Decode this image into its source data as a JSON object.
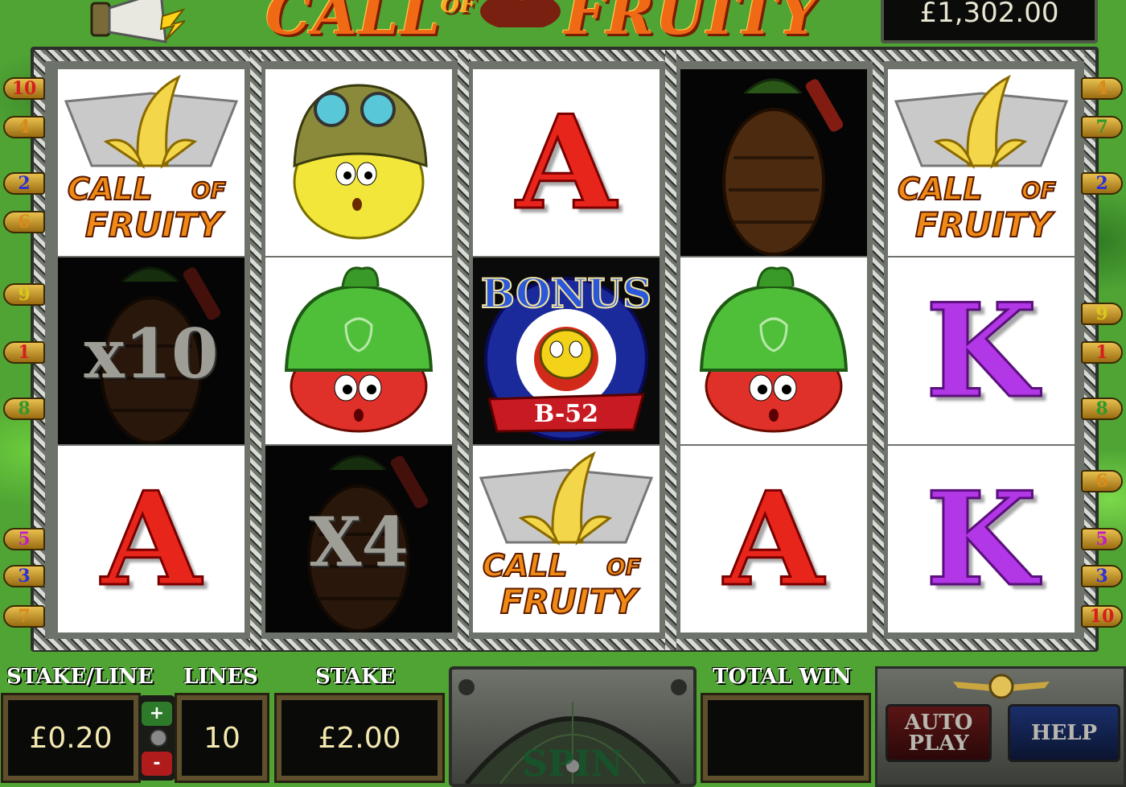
{
  "game": {
    "title_left": "CALL",
    "title_of": "OF",
    "title_right": "FRUITY",
    "credit": "£1,302.00"
  },
  "reels": [
    [
      {
        "symbol": "call-of-fruity-wild",
        "line1": "CALL",
        "of": "OF",
        "line2": "FRUITY"
      },
      {
        "symbol": "pineapple-grenade-multiplier",
        "multiplier": "x10"
      },
      {
        "symbol": "letter-a",
        "text": "A"
      }
    ],
    [
      {
        "symbol": "lemon-soldier"
      },
      {
        "symbol": "strawberry-soldier"
      },
      {
        "symbol": "pineapple-grenade-multiplier",
        "multiplier": "X4"
      }
    ],
    [
      {
        "symbol": "letter-a",
        "text": "A"
      },
      {
        "symbol": "bonus-b52",
        "title": "BONUS",
        "ribbon": "B-52"
      },
      {
        "symbol": "call-of-fruity-wild",
        "line1": "CALL",
        "of": "OF",
        "line2": "FRUITY"
      }
    ],
    [
      {
        "symbol": "pineapple-grenade-dark"
      },
      {
        "symbol": "strawberry-soldier"
      },
      {
        "symbol": "letter-a",
        "text": "A"
      }
    ],
    [
      {
        "symbol": "call-of-fruity-wild",
        "line1": "CALL",
        "of": "OF",
        "line2": "FRUITY"
      },
      {
        "symbol": "letter-k",
        "text": "K"
      },
      {
        "symbol": "letter-k",
        "text": "K"
      }
    ]
  ],
  "paylines_left": [
    {
      "num": "10",
      "color": "#d71e1e"
    },
    {
      "num": "4",
      "color": "#d88a1a"
    },
    {
      "num": "2",
      "color": "#2d2fd8"
    },
    {
      "num": "6",
      "color": "#d88a1a"
    },
    {
      "num": "9",
      "color": "#d8c81a"
    },
    {
      "num": "1",
      "color": "#d71e1e"
    },
    {
      "num": "8",
      "color": "#2f9a2a"
    },
    {
      "num": "5",
      "color": "#c21ec8"
    },
    {
      "num": "3",
      "color": "#2d2fd8"
    },
    {
      "num": "7",
      "color": "#d88a1a"
    }
  ],
  "paylines_right": [
    {
      "num": "4",
      "color": "#d88a1a"
    },
    {
      "num": "7",
      "color": "#2f9a2a"
    },
    {
      "num": "2",
      "color": "#2d2fd8"
    },
    {
      "num": "9",
      "color": "#d8c81a"
    },
    {
      "num": "1",
      "color": "#d71e1e"
    },
    {
      "num": "8",
      "color": "#2f9a2a"
    },
    {
      "num": "6",
      "color": "#d88a1a"
    },
    {
      "num": "5",
      "color": "#c21ec8"
    },
    {
      "num": "3",
      "color": "#2d2fd8"
    },
    {
      "num": "10",
      "color": "#d71e1e"
    }
  ],
  "controls": {
    "stake_line_label": "STAKE/LINE",
    "stake_line_value": "£0.20",
    "plus": "+",
    "minus": "-",
    "lines_label": "LINES",
    "lines_value": "10",
    "stake_label": "STAKE",
    "stake_value": "£2.00",
    "spin_label": "SPIN",
    "total_win_label": "TOTAL WIN",
    "total_win_value": "",
    "auto_play_line1": "AUTO",
    "auto_play_line2": "PLAY",
    "help_label": "HELP"
  }
}
